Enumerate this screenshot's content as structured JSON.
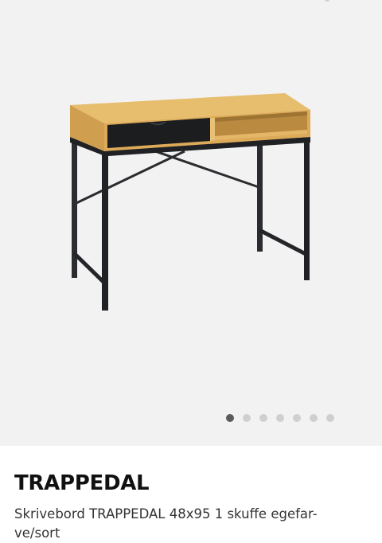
{
  "product": {
    "title": "TRAPPEDAL",
    "description_lines": [
      "Skrivebord TRAPPEDAL 48x95 1 skuffe egefar-",
      "ve/sort"
    ]
  },
  "gallery": {
    "image_count": 7,
    "active_index": 0,
    "dot_color": "#cfcfcf",
    "active_dot_color": "#5b5b5b"
  },
  "colors": {
    "background_gallery": "#f2f2f2",
    "oak": "#e3b766",
    "drawer_black": "#1b1d1f",
    "frame_black": "#232528"
  }
}
